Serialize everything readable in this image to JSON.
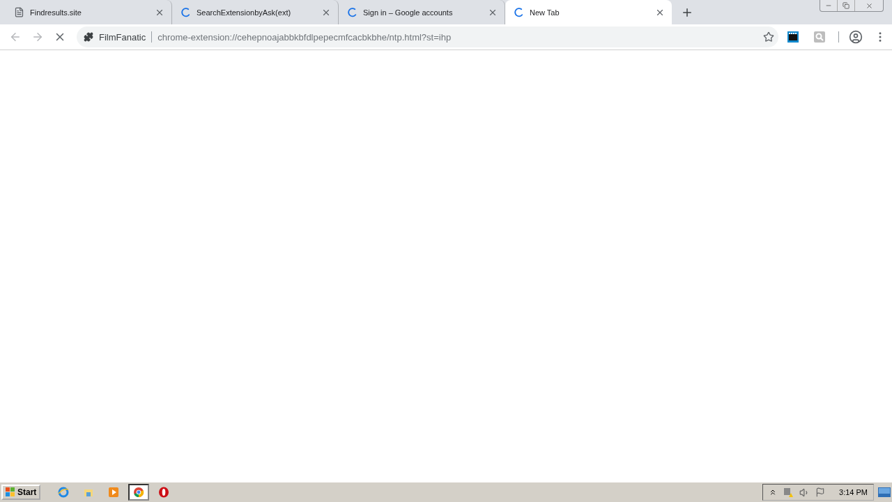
{
  "tabs": [
    {
      "title": "Findresults.site",
      "kind": "page",
      "selected": false
    },
    {
      "title": "SearchExtensionbyAsk(ext)",
      "kind": "loading",
      "selected": false
    },
    {
      "title": "Sign in – Google accounts",
      "kind": "loading",
      "selected": false
    },
    {
      "title": "New Tab",
      "kind": "loading",
      "selected": true
    }
  ],
  "nav_buttons": [
    {
      "kind": "back",
      "disabled": true
    },
    {
      "kind": "forward",
      "disabled": true
    },
    {
      "kind": "stop",
      "disabled": false
    }
  ],
  "omnibox": {
    "site_name": "FilmFanatic",
    "url": "chrome-extension://cehepnoajabbkbfdlpepecmfcacbkbhe/ntp.html?st=ihp"
  },
  "taskbar": {
    "start": "Start",
    "apps": [
      {
        "kind": "ie",
        "selected": false
      },
      {
        "kind": "explorer",
        "selected": false
      },
      {
        "kind": "media",
        "selected": false
      },
      {
        "kind": "chrome",
        "selected": true
      },
      {
        "kind": "opera",
        "selected": false
      }
    ],
    "clock": "3:14 PM"
  }
}
